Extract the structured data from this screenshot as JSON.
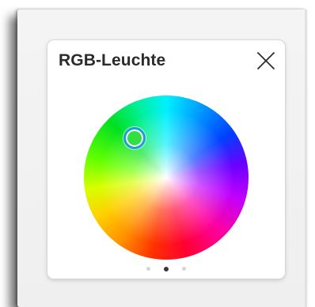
{
  "panel": {
    "title": "RGB-Leuchte",
    "close_icon": "close-icon"
  },
  "color_wheel": {
    "selected_color": "#30e040",
    "picker_ring_color": "#1aa0d8"
  },
  "pagination": {
    "pages": 3,
    "active_page": 2
  }
}
